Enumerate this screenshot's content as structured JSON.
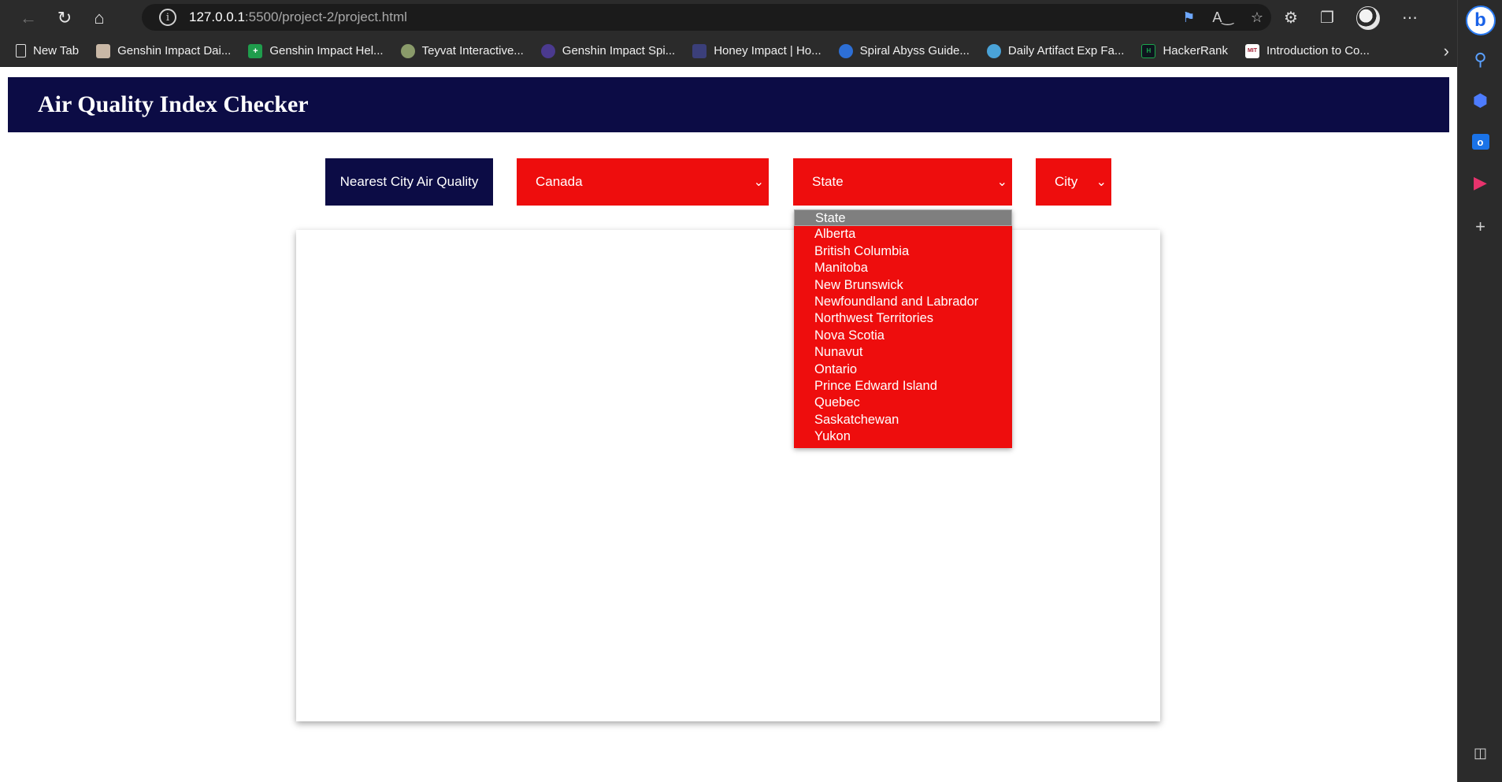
{
  "browser": {
    "url_host": "127.0.0.1",
    "url_path": ":5500/project-2/project.html",
    "bookmarks": [
      {
        "label": "New Tab",
        "icon": "page-icon"
      },
      {
        "label": "Genshin Impact Dai...",
        "icon": "genshin-icon"
      },
      {
        "label": "Genshin Impact Hel...",
        "icon": "plus-green-icon"
      },
      {
        "label": "Teyvat Interactive...",
        "icon": "teyvat-map-icon"
      },
      {
        "label": "Genshin Impact Spi...",
        "icon": "spiral-icon"
      },
      {
        "label": "Honey Impact | Ho...",
        "icon": "honey-impact-icon"
      },
      {
        "label": "Spiral Abyss Guide...",
        "icon": "abyss-icon"
      },
      {
        "label": "Daily Artifact Exp Fa...",
        "icon": "globe-icon"
      },
      {
        "label": "HackerRank",
        "icon": "hackerrank-icon"
      },
      {
        "label": "Introduction to Co...",
        "icon": "mit-ocw-icon"
      }
    ]
  },
  "app": {
    "title": "Air Quality Index Checker",
    "nearest_button": "Nearest City Air Quality",
    "country_select": {
      "value": "Canada"
    },
    "state_select": {
      "value": "State"
    },
    "city_select": {
      "value": "City"
    },
    "state_options": [
      "State",
      "Alberta",
      "British Columbia",
      "Manitoba",
      "New Brunswick",
      "Newfoundland and Labrador",
      "Northwest Territories",
      "Nova Scotia",
      "Nunavut",
      "Ontario",
      "Prince Edward Island",
      "Quebec",
      "Saskatchewan",
      "Yukon"
    ],
    "selected_state_index": 0
  },
  "colors": {
    "navy": "#0c0c45",
    "red": "#ee0d0d",
    "highlight": "#7f7f7f"
  }
}
